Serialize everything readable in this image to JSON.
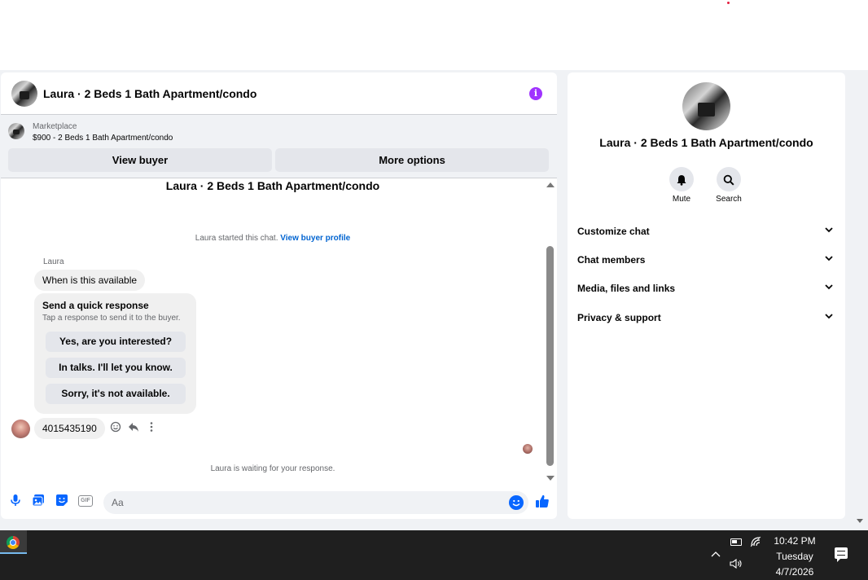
{
  "chat": {
    "header_title": "Laura · 2 Beds 1 Bath Apartment/condo",
    "info_icon": "i",
    "marketplace": {
      "label": "Marketplace",
      "listing": "$900 - 2 Beds 1 Bath Apartment/condo",
      "view_buyer_label": "View buyer",
      "more_options_label": "More options"
    },
    "conversation_title": "Laura · 2 Beds 1 Bath Apartment/condo",
    "started_text": "Laura started this chat.",
    "view_profile_link": "View buyer profile",
    "sender_name": "Laura",
    "message_1": "When is this available",
    "quick_response": {
      "title": "Send a quick response",
      "subtitle": "Tap a response to send it to the buyer.",
      "options": [
        "Yes, are you interested?",
        "In talks. I'll let you know.",
        "Sorry, it's not available."
      ]
    },
    "message_2": "4015435190",
    "waiting_text": "Laura is waiting for your response.",
    "composer": {
      "placeholder": "Aa",
      "gif_label": "GIF"
    }
  },
  "info_panel": {
    "title": "Laura · 2 Beds 1 Bath Apartment/condo",
    "mute_label": "Mute",
    "search_label": "Search",
    "sections": [
      "Customize chat",
      "Chat members",
      "Media, files and links",
      "Privacy & support"
    ]
  },
  "taskbar": {
    "time": "10:42 PM",
    "day": "Tuesday",
    "date": "4/7/2026"
  },
  "colors": {
    "accent": "#0866ff",
    "info_purple": "#a033ff",
    "link": "#0064d1",
    "taskbar": "#1f1f1f"
  },
  "icons": [
    "info-icon",
    "mic-icon",
    "photo-icon",
    "sticker-icon",
    "gif-icon",
    "emoji-icon",
    "like-icon",
    "react-icon",
    "reply-icon",
    "more-icon",
    "bell-icon",
    "search-icon",
    "chevron-down-icon",
    "chrome-icon",
    "battery-icon",
    "wifi-icon",
    "volume-icon",
    "notification-icon"
  ]
}
